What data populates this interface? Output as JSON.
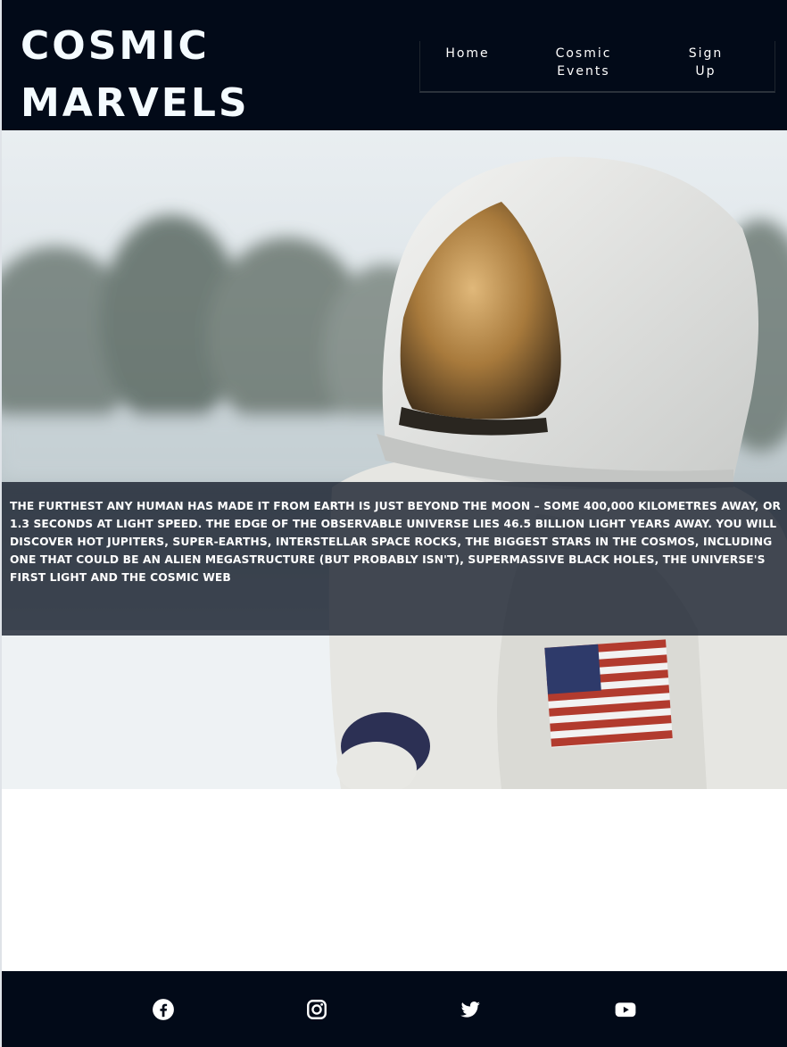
{
  "header": {
    "logo_line1": "COSMIC",
    "logo_line2": "MARVELS"
  },
  "nav": {
    "home": "Home",
    "events_line1": "Cosmic",
    "events_line2": "Events",
    "signup_line1": "Sign",
    "signup_line2": "Up"
  },
  "hero": {
    "text": "The furthest any human has made it from Earth is just beyond the Moon – some 400,000 kilometres away, or 1.3 seconds at light speed. The edge of the observable Universe lies 46.5 billion light years away. You will discover hot Jupiters, super-Earths, interstellar space rocks, the biggest stars in the cosmos, including one that could be an alien megastructure (but probably isn't), supermassive black holes, the Universe's first light and the cosmic web"
  },
  "footer": {
    "icons": [
      "facebook-icon",
      "instagram-icon",
      "twitter-icon",
      "youtube-icon"
    ]
  },
  "colors": {
    "header_bg": "#020a18",
    "footer_bg": "#020a18",
    "caption_bg": "rgba(18,26,40,0.78)",
    "text_light": "#ffffff"
  }
}
